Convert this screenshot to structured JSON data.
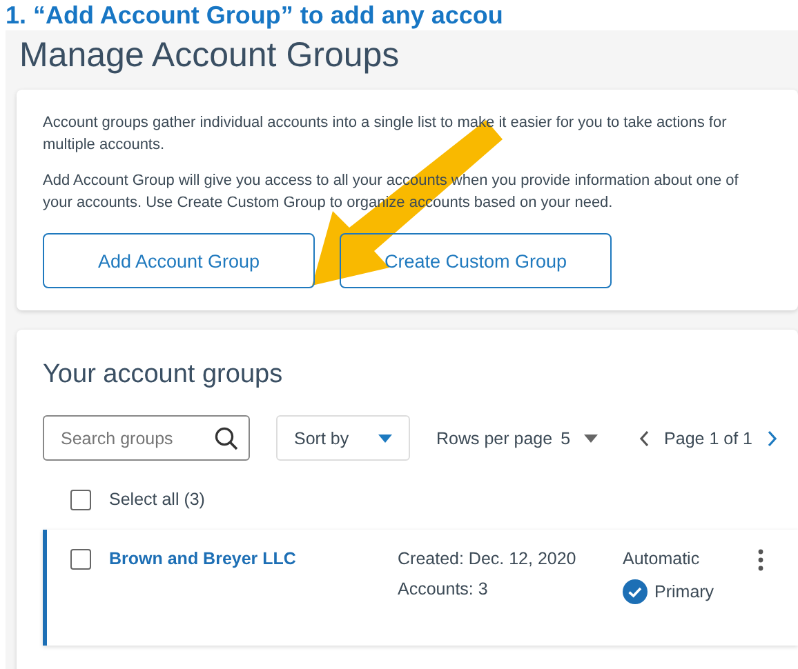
{
  "heading": "1. “Add Account Group” to add any accou",
  "page_title": "Manage Account Groups",
  "intro": {
    "paragraphs": [
      "Account groups gather individual accounts into a single list to make it easier for you to take actions for multiple accounts.",
      "Add Account Group will give you access to all your accounts when you provide information about one of your accounts. Use Create Custom Group to organize accounts based on your need."
    ],
    "buttons": [
      "Add Account Group",
      "Create Custom Group"
    ]
  },
  "groups": {
    "title": "Your account groups",
    "search": {
      "placeholder": "Search groups"
    },
    "sort": {
      "label": "Sort by"
    },
    "rows_per_page": {
      "label": "Rows per page",
      "value": "5"
    },
    "pagination": {
      "label": "Page 1 of 1",
      "prev_disabled": true,
      "next_disabled": false
    },
    "select_all": {
      "label": "Select all (3)",
      "checked": false
    },
    "rows": [
      {
        "name": "Brown and Breyer LLC",
        "created": "Created: Dec. 12, 2020",
        "accounts": "Accounts: 3",
        "type": "Automatic",
        "primary": true,
        "primary_label": "Primary",
        "checked": false
      }
    ]
  }
}
